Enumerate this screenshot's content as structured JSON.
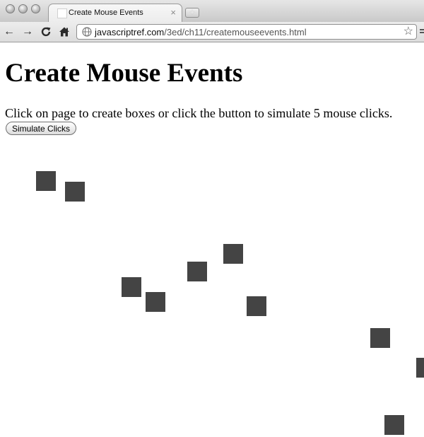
{
  "browser": {
    "tab_title": "Create Mouse Events",
    "tab_close": "×",
    "new_tab": "+",
    "url_host": "javascriptref.com",
    "url_path": "/3ed/ch11/createmouseevents.html",
    "back_glyph": "←",
    "forward_glyph": "→",
    "reload_glyph": "C",
    "star_glyph": "☆"
  },
  "page": {
    "heading": "Create Mouse Events",
    "instructions": "Click on page to create boxes or click the button to simulate 5 mouse clicks.",
    "button_label": "Simulate Clicks",
    "box_color": "#444444",
    "box_count": 11
  }
}
